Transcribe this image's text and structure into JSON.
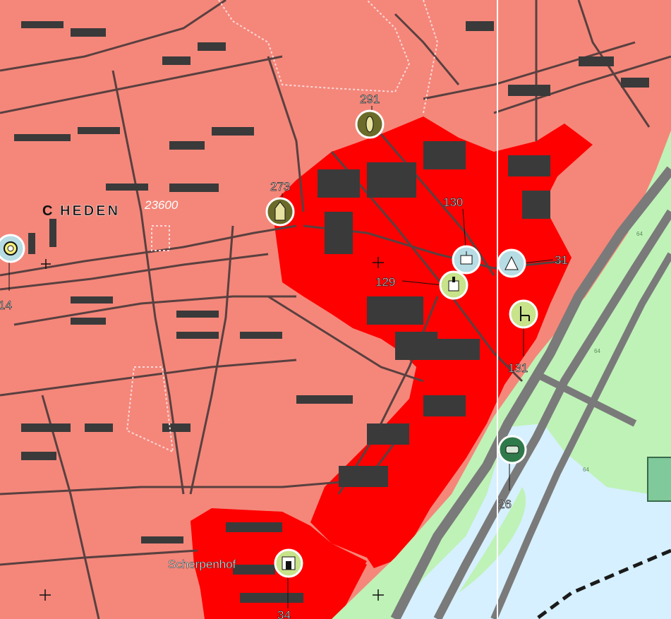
{
  "map": {
    "place_label": "HEDEN",
    "place_label_partial_letter": "C",
    "district_label": "Scherpenhof",
    "grid_code": "23600",
    "vegetation_code": "64"
  },
  "colors": {
    "residential": "#f4877a",
    "dense_center": "#ff0000",
    "building": "#3a3a3a",
    "road_casing": "#5a4040",
    "green": "#bff2b7",
    "water": "#d6f0ff",
    "railway": "#7a7a7a",
    "boundary_dotted": "#ffd8d8",
    "grid_line": "#ffffff",
    "marker_olive": "#6b6b2a",
    "marker_lightgreen": "#c8e38a",
    "marker_lightblue": "#b7dce4",
    "marker_darkgreen": "#2f7a4a",
    "marker_yellow": "#f6f07a"
  },
  "markers": [
    {
      "id": "291",
      "label": "291",
      "icon": "tower-icon",
      "color": "marker_olive"
    },
    {
      "id": "273",
      "label": "273",
      "icon": "chapel-icon",
      "color": "marker_olive"
    },
    {
      "id": "130",
      "label": "130",
      "icon": "building-icon",
      "color": "marker_lightblue"
    },
    {
      "id": "31",
      "label": "31",
      "icon": "triangle-icon",
      "color": "marker_lightblue"
    },
    {
      "id": "129",
      "label": "129",
      "icon": "church-icon",
      "color": "marker_lightgreen"
    },
    {
      "id": "131",
      "label": "131",
      "icon": "chair-icon",
      "color": "marker_lightgreen"
    },
    {
      "id": "26",
      "label": "26",
      "icon": "bunker-icon",
      "color": "marker_darkgreen"
    },
    {
      "id": "34",
      "label": "34",
      "icon": "gate-icon",
      "color": "marker_lightgreen"
    },
    {
      "id": "14",
      "label": "14",
      "icon": "ring-icon",
      "color": "marker_yellow"
    }
  ]
}
